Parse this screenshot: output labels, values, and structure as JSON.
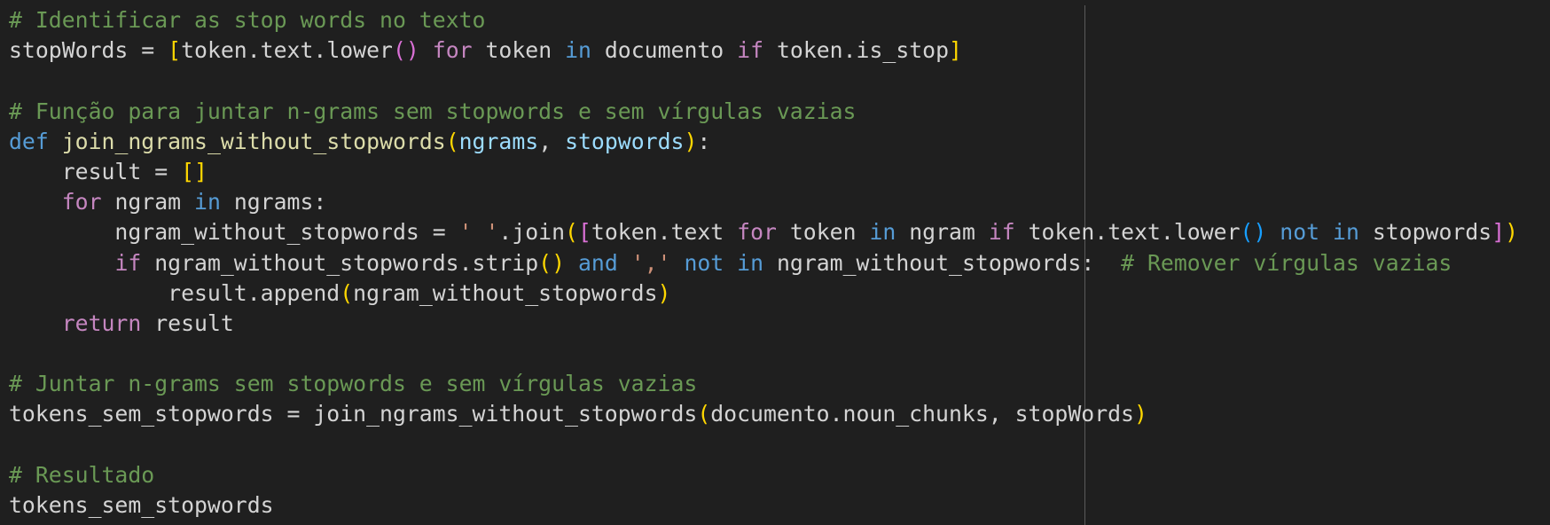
{
  "editor": {
    "language": "python",
    "theme": {
      "background": "#1f1f1f",
      "text": "#d4d4d4",
      "comment": "#6a9955",
      "keyword": "#c586c0",
      "def_keyword": "#569cd6",
      "function": "#dcdcaa",
      "parameter": "#9cdcfe",
      "string": "#ce9178",
      "bracket_level1": "#ffd700",
      "bracket_level2": "#da70d6",
      "bracket_level3": "#179fff",
      "ruler": "#5a5a5a"
    },
    "lines": [
      [
        {
          "t": "comment",
          "v": "# Identificar as stop words no texto"
        }
      ],
      [
        {
          "t": "plain",
          "v": "stopWords = "
        },
        {
          "t": "b1",
          "v": "["
        },
        {
          "t": "plain",
          "v": "token.text.lower"
        },
        {
          "t": "b2",
          "v": "()"
        },
        {
          "t": "plain",
          "v": " "
        },
        {
          "t": "keyword",
          "v": "for"
        },
        {
          "t": "plain",
          "v": " token "
        },
        {
          "t": "in",
          "v": "in"
        },
        {
          "t": "plain",
          "v": " documento "
        },
        {
          "t": "keyword",
          "v": "if"
        },
        {
          "t": "plain",
          "v": " token.is_stop"
        },
        {
          "t": "b1",
          "v": "]"
        }
      ],
      [],
      [
        {
          "t": "comment",
          "v": "# Função para juntar n-grams sem stopwords e sem vírgulas vazias"
        }
      ],
      [
        {
          "t": "def",
          "v": "def"
        },
        {
          "t": "plain",
          "v": " "
        },
        {
          "t": "func",
          "v": "join_ngrams_without_stopwords"
        },
        {
          "t": "b1",
          "v": "("
        },
        {
          "t": "param",
          "v": "ngrams"
        },
        {
          "t": "plain",
          "v": ", "
        },
        {
          "t": "param",
          "v": "stopwords"
        },
        {
          "t": "b1",
          "v": ")"
        },
        {
          "t": "plain",
          "v": ":"
        }
      ],
      [
        {
          "t": "plain",
          "v": "    result = "
        },
        {
          "t": "b1",
          "v": "[]"
        }
      ],
      [
        {
          "t": "plain",
          "v": "    "
        },
        {
          "t": "keyword",
          "v": "for"
        },
        {
          "t": "plain",
          "v": " ngram "
        },
        {
          "t": "in",
          "v": "in"
        },
        {
          "t": "plain",
          "v": " ngrams:"
        }
      ],
      [
        {
          "t": "plain",
          "v": "        ngram_without_stopwords = "
        },
        {
          "t": "string",
          "v": "' '"
        },
        {
          "t": "plain",
          "v": ".join"
        },
        {
          "t": "b1",
          "v": "("
        },
        {
          "t": "b2",
          "v": "["
        },
        {
          "t": "plain",
          "v": "token.text "
        },
        {
          "t": "keyword",
          "v": "for"
        },
        {
          "t": "plain",
          "v": " token "
        },
        {
          "t": "in",
          "v": "in"
        },
        {
          "t": "plain",
          "v": " ngram "
        },
        {
          "t": "keyword",
          "v": "if"
        },
        {
          "t": "plain",
          "v": " token.text.lower"
        },
        {
          "t": "b3",
          "v": "()"
        },
        {
          "t": "plain",
          "v": " "
        },
        {
          "t": "in",
          "v": "not"
        },
        {
          "t": "plain",
          "v": " "
        },
        {
          "t": "in",
          "v": "in"
        },
        {
          "t": "plain",
          "v": " stopwords"
        },
        {
          "t": "b2",
          "v": "]"
        },
        {
          "t": "b1",
          "v": ")"
        }
      ],
      [
        {
          "t": "plain",
          "v": "        "
        },
        {
          "t": "keyword",
          "v": "if"
        },
        {
          "t": "plain",
          "v": " ngram_without_stopwords.strip"
        },
        {
          "t": "b1",
          "v": "()"
        },
        {
          "t": "plain",
          "v": " "
        },
        {
          "t": "in",
          "v": "and"
        },
        {
          "t": "plain",
          "v": " "
        },
        {
          "t": "string",
          "v": "','"
        },
        {
          "t": "plain",
          "v": " "
        },
        {
          "t": "in",
          "v": "not"
        },
        {
          "t": "plain",
          "v": " "
        },
        {
          "t": "in",
          "v": "in"
        },
        {
          "t": "plain",
          "v": " ngram_without_stopwords:  "
        },
        {
          "t": "comment",
          "v": "# Remover vírgulas vazias"
        }
      ],
      [
        {
          "t": "plain",
          "v": "            result.append"
        },
        {
          "t": "b1",
          "v": "("
        },
        {
          "t": "plain",
          "v": "ngram_without_stopwords"
        },
        {
          "t": "b1",
          "v": ")"
        }
      ],
      [
        {
          "t": "plain",
          "v": "    "
        },
        {
          "t": "keyword",
          "v": "return"
        },
        {
          "t": "plain",
          "v": " result"
        }
      ],
      [],
      [
        {
          "t": "comment",
          "v": "# Juntar n-grams sem stopwords e sem vírgulas vazias"
        }
      ],
      [
        {
          "t": "plain",
          "v": "tokens_sem_stopwords = join_ngrams_without_stopwords"
        },
        {
          "t": "b1",
          "v": "("
        },
        {
          "t": "plain",
          "v": "documento.noun_chunks, stopWords"
        },
        {
          "t": "b1",
          "v": ")"
        }
      ],
      [],
      [
        {
          "t": "comment",
          "v": "# Resultado"
        }
      ],
      [
        {
          "t": "plain",
          "v": "tokens_sem_stopwords"
        }
      ]
    ]
  }
}
